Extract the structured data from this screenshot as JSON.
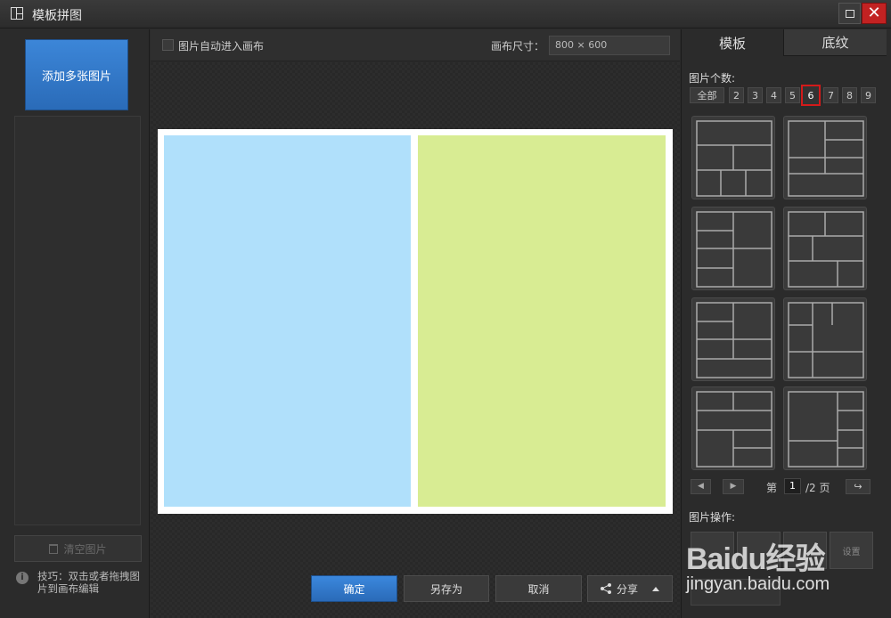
{
  "window": {
    "title": "模板拼图",
    "close_glyph": "✕"
  },
  "left": {
    "add_button": "添加多张图片",
    "clear_button": "清空图片",
    "tip_icon": "i",
    "tip_text": "技巧：双击或者拖拽图片到画布编辑"
  },
  "toolbar": {
    "auto_enter_label": "图片自动进入画布",
    "auto_enter_checked": false,
    "canvas_size_label": "画布尺寸：",
    "canvas_size_value": "800 × 600"
  },
  "canvas": {
    "photo_colors": [
      "#b0e0fb",
      "#d8ec93"
    ]
  },
  "bottom_buttons": {
    "ok": "确定",
    "save_as": "另存为",
    "cancel": "取消",
    "share": "分享"
  },
  "right": {
    "tabs": [
      "模板",
      "底纹"
    ],
    "active_tab": "模板",
    "count_label": "图片个数:",
    "counts": [
      "全部",
      "2",
      "3",
      "4",
      "5",
      "6",
      "7",
      "8",
      "9"
    ],
    "selected_count": "6",
    "pager": {
      "prev_icon": "◀",
      "next_icon": "▶",
      "prefix": "第",
      "page": "1",
      "suffix": "/2 页",
      "go_icon": "↪"
    },
    "ops_label": "图片操作:",
    "op_buttons": [
      "",
      "",
      "",
      "设置"
    ]
  },
  "watermark": {
    "logo": "Baidu经验",
    "url": "jingyan.baidu.com"
  }
}
